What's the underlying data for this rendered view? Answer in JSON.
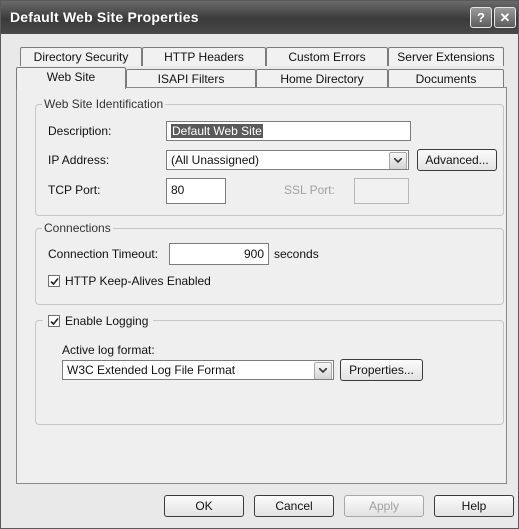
{
  "window": {
    "title": "Default Web Site Properties",
    "help_glyph": "?",
    "close_glyph": "✕"
  },
  "tabs": {
    "row1": [
      "Directory Security",
      "HTTP Headers",
      "Custom Errors",
      "Server Extensions"
    ],
    "row2": [
      "Web Site",
      "ISAPI Filters",
      "Home Directory",
      "Documents"
    ],
    "active": "Web Site"
  },
  "identification": {
    "group_label": "Web Site Identification",
    "description_label": "Description:",
    "description_value": "Default Web Site",
    "ip_label": "IP Address:",
    "ip_value": "(All Unassigned)",
    "advanced_button": "Advanced...",
    "tcp_label": "TCP Port:",
    "tcp_value": "80",
    "ssl_label": "SSL Port:",
    "ssl_value": ""
  },
  "connections": {
    "group_label": "Connections",
    "timeout_label": "Connection Timeout:",
    "timeout_value": "900",
    "timeout_unit": "seconds",
    "keepalive_label": "HTTP Keep-Alives Enabled",
    "keepalive_checked": true
  },
  "logging": {
    "enable_label": "Enable Logging",
    "enable_checked": true,
    "format_label": "Active log format:",
    "format_value": "W3C Extended Log File Format",
    "properties_button": "Properties..."
  },
  "buttons": {
    "ok": "OK",
    "cancel": "Cancel",
    "apply": "Apply",
    "help": "Help"
  },
  "icons": {
    "dropdown": "chevron-down-icon",
    "checkbox": "check-icon"
  }
}
